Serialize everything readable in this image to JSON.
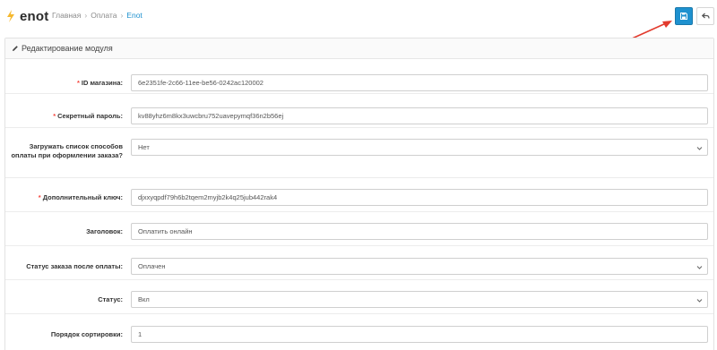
{
  "header": {
    "logo_text": "enot",
    "breadcrumb": [
      "Главная",
      "Оплата",
      "Enot"
    ],
    "breadcrumb_sep": "›"
  },
  "panel": {
    "title": "Редактирование модуля"
  },
  "form": {
    "rows": [
      {
        "label": "ID магазина:",
        "required": true,
        "type": "input",
        "value": "6e2351fe-2c66-11ee-be56-0242ac120002"
      },
      {
        "label": "Секретный пароль:",
        "required": true,
        "type": "input",
        "value": "kv88yhz6m8kx3uwcbru752uavepymqf36n2b56ej"
      },
      {
        "label": "Загружать список способов оплаты при оформлении заказа?",
        "required": false,
        "type": "select",
        "value": "Нет"
      },
      {
        "label": "Дополнительный ключ:",
        "required": true,
        "type": "input",
        "value": "djxxyqpdf79h6b2tqem2myjb2k4q25jub442rak4"
      },
      {
        "label": "Заголовок:",
        "required": false,
        "type": "input",
        "value": "Оплатить онлайн"
      },
      {
        "label": "Статус заказа после оплаты:",
        "required": false,
        "type": "select",
        "value": "Оплачен"
      },
      {
        "label": "Статус:",
        "required": false,
        "type": "select",
        "value": "Вкл"
      },
      {
        "label": "Порядок сортировки:",
        "required": false,
        "type": "input",
        "value": "1"
      }
    ]
  },
  "colors": {
    "accent": "#1e91cf",
    "required": "#f5443c",
    "annotation_arrow": "#e23b2e",
    "logo_mark": "#f5b82e"
  },
  "icons": {
    "save": "save-icon",
    "back": "reply-icon",
    "panel": "pencil-icon",
    "select": "chevron-down-icon"
  }
}
